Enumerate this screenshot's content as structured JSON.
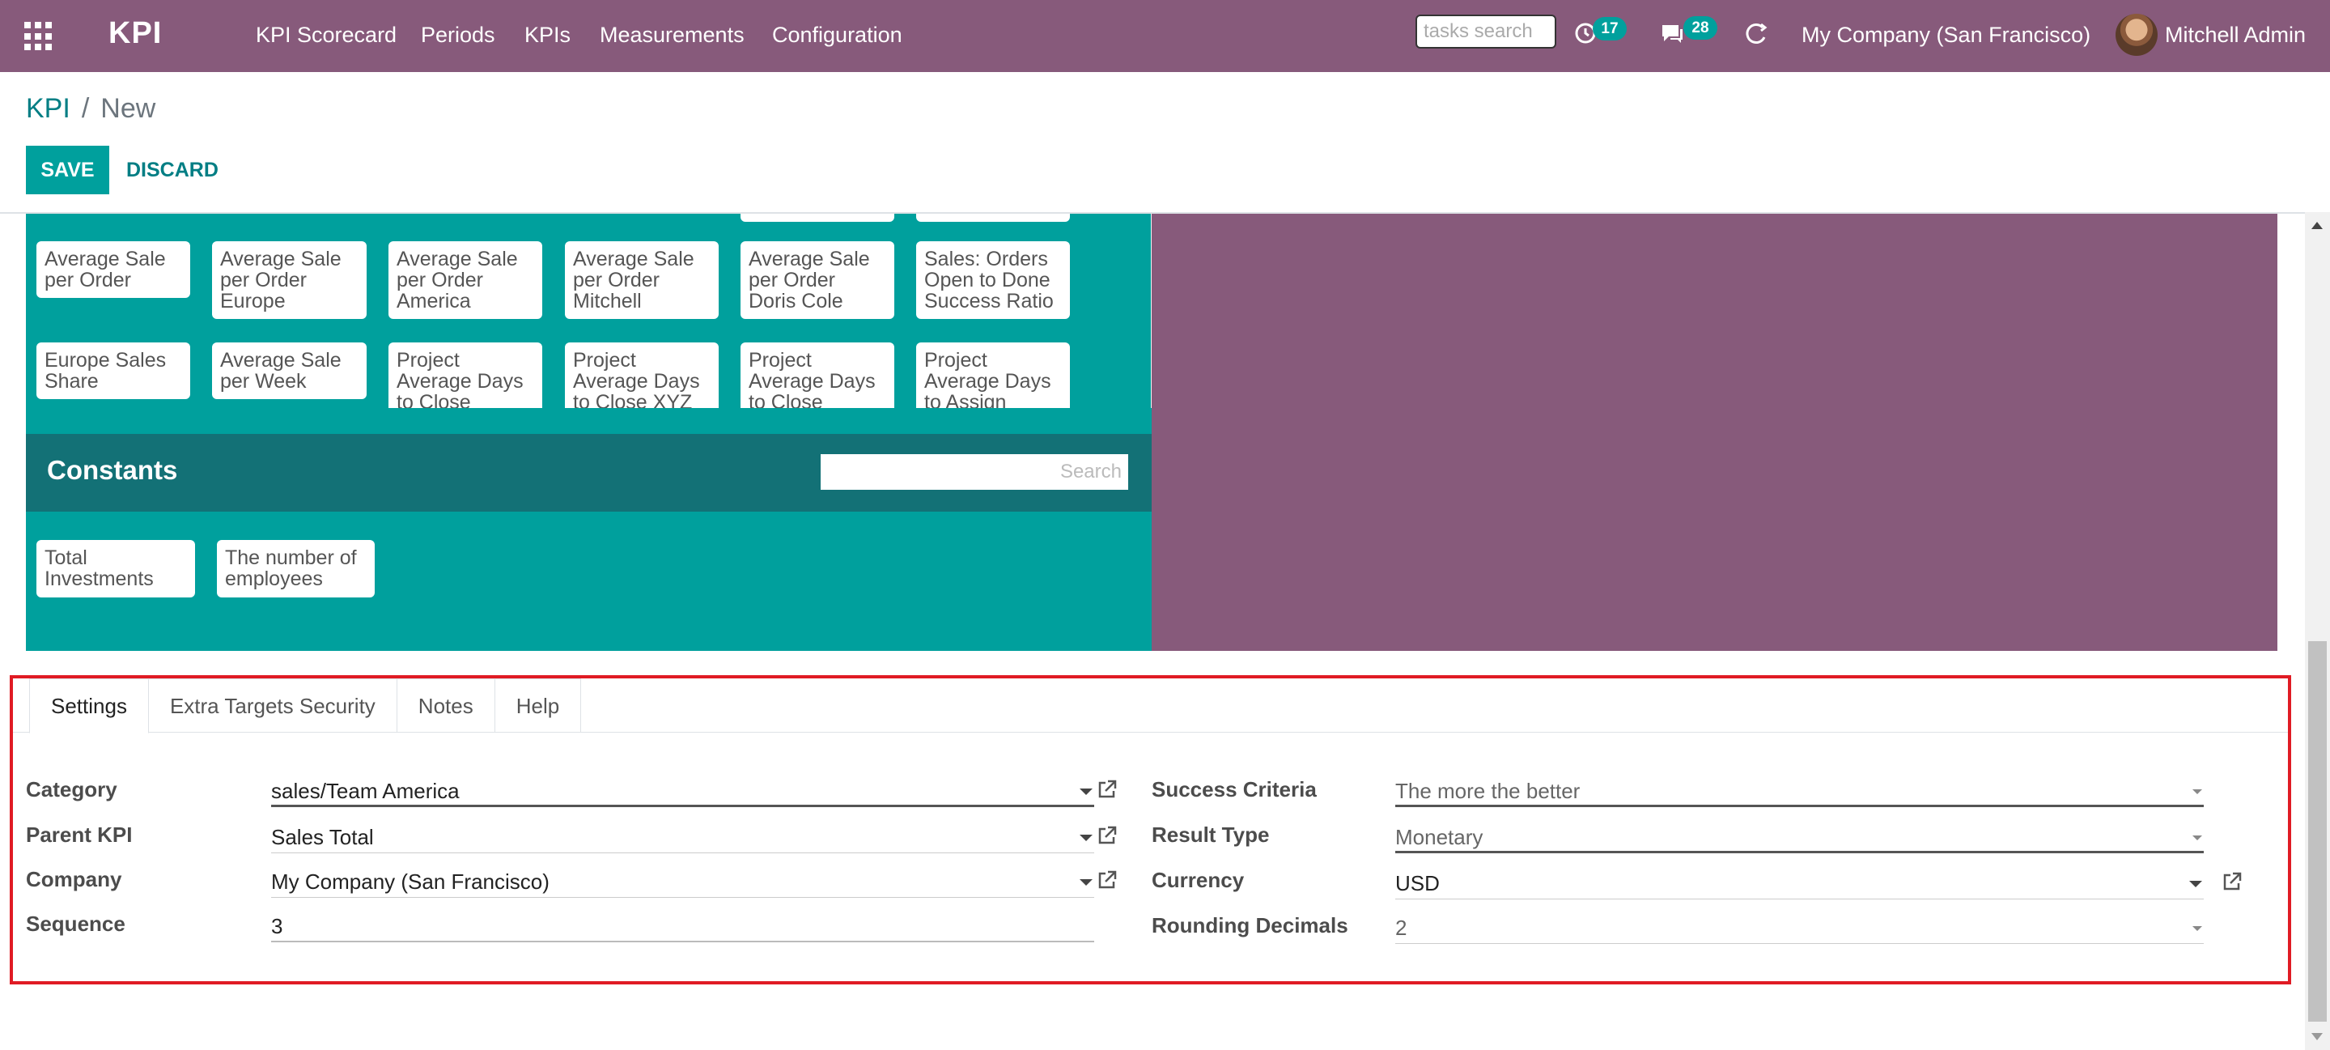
{
  "navbar": {
    "brand": "KPI",
    "menu": [
      "KPI Scorecard",
      "Periods",
      "KPIs",
      "Measurements",
      "Configuration"
    ],
    "task_search_placeholder": "tasks search",
    "activity_count": "17",
    "messages_count": "28",
    "company": "My Company (San Francisco)",
    "user": "Mitchell Admin"
  },
  "breadcrumb": {
    "parent": "KPI",
    "separator": "/",
    "current": "New"
  },
  "buttons": {
    "save": "SAVE",
    "discard": "DISCARD"
  },
  "kpi_tiles": [
    [
      "Average Sale per Order",
      "Average Sale per Order Europe",
      "Average Sale per Order America",
      "Average Sale per Order Mitchell",
      "Average Sale per Order Doris Cole",
      "Sales: Orders Open to Done Success Ratio"
    ],
    [
      "Europe Sales Share",
      "Average Sale per Week",
      "Project Average Days to Close",
      "Project Average Days to Close XYZ",
      "Project Average Days to Close",
      "Project Average Days to Assign"
    ]
  ],
  "constants": {
    "title": "Constants",
    "search_placeholder": "Search",
    "items": [
      "Total Investments",
      "The number of employees"
    ]
  },
  "tabs": [
    "Settings",
    "Extra Targets Security",
    "Notes",
    "Help"
  ],
  "settings": {
    "left": [
      {
        "label": "Category",
        "value": "sales/Team America"
      },
      {
        "label": "Parent KPI",
        "value": "Sales Total"
      },
      {
        "label": "Company",
        "value": "My Company (San Francisco)"
      },
      {
        "label": "Sequence",
        "value": "3"
      }
    ],
    "right": [
      {
        "label": "Success Criteria",
        "value": "The more the better"
      },
      {
        "label": "Result Type",
        "value": "Monetary"
      },
      {
        "label": "Currency",
        "value": "USD"
      },
      {
        "label": "Rounding Decimals",
        "value": "2"
      }
    ]
  },
  "colors": {
    "navbar": "#875a7b",
    "teal": "#00a09d",
    "dark_teal": "#137176",
    "highlight_border": "#e01b24"
  }
}
